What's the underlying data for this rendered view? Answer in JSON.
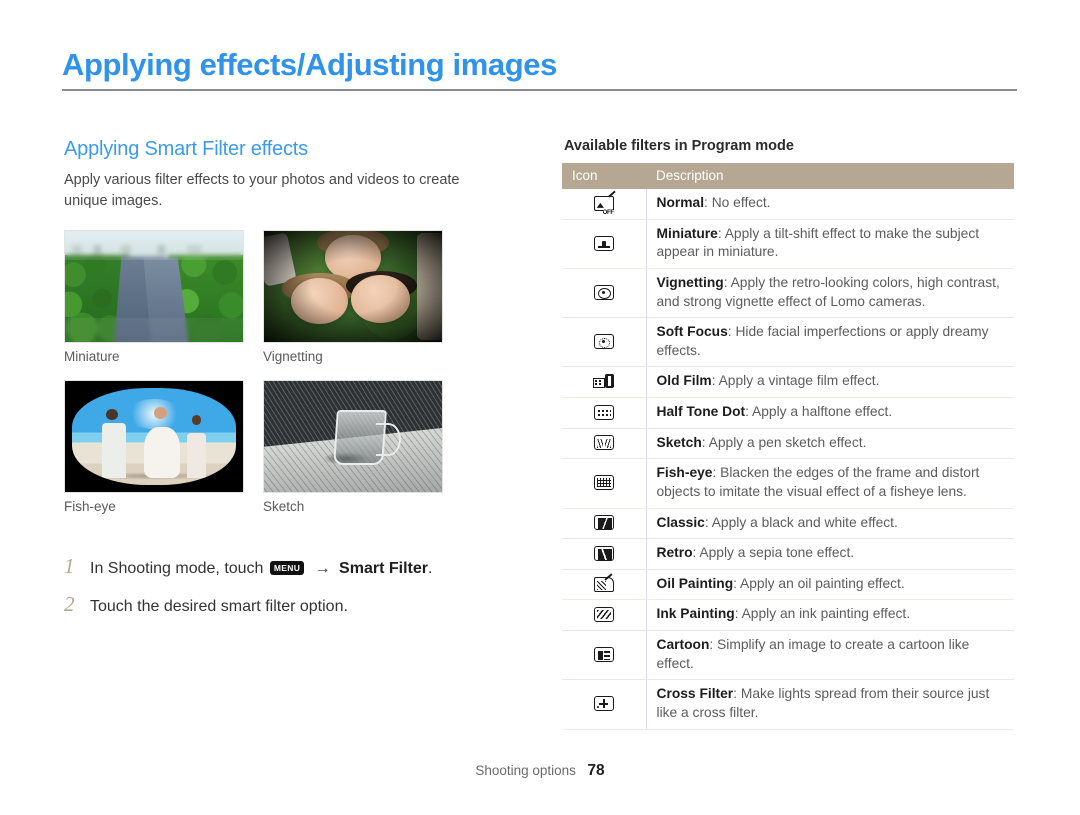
{
  "document": {
    "title": "Applying effects/Adjusting images",
    "footer_label": "Shooting options",
    "footer_page": "78"
  },
  "left_column": {
    "section_title": "Applying Smart Filter effects",
    "intro": "Apply various filter effects to your photos and videos to create unique images.",
    "samples": [
      {
        "caption": "Miniature",
        "art": "miniature"
      },
      {
        "caption": "Vignetting",
        "art": "vignetting"
      },
      {
        "caption": "Fish-eye",
        "art": "fisheye"
      },
      {
        "caption": "Sketch",
        "art": "sketch"
      }
    ],
    "steps": [
      {
        "number": "1",
        "before": "In Shooting mode, touch",
        "chip": "MENU",
        "arrow": "→",
        "bold": "Smart Filter",
        "after": "."
      },
      {
        "number": "2",
        "before": "Touch the desired smart filter option.",
        "chip": "",
        "arrow": "",
        "bold": "",
        "after": ""
      }
    ]
  },
  "right_column": {
    "table_caption": "Available filters in Program mode",
    "columns": {
      "icon": "Icon",
      "description": "Description"
    },
    "rows": [
      {
        "icon": "filter-normal-icon",
        "name": "Normal",
        "desc": ": No effect."
      },
      {
        "icon": "filter-miniature-icon",
        "name": "Miniature",
        "desc": ": Apply a tilt-shift effect to make the subject appear in miniature."
      },
      {
        "icon": "filter-vignetting-icon",
        "name": "Vignetting",
        "desc": ": Apply the retro-looking colors, high contrast, and strong vignette effect of Lomo cameras."
      },
      {
        "icon": "filter-soft-focus-icon",
        "name": "Soft Focus",
        "desc": ": Hide facial imperfections or apply dreamy effects."
      },
      {
        "icon": "filter-old-film-icon",
        "name": "Old Film",
        "desc": ": Apply a vintage film effect."
      },
      {
        "icon": "filter-half-tone-dot-icon",
        "name": "Half Tone Dot",
        "desc": ": Apply a halftone effect."
      },
      {
        "icon": "filter-sketch-icon",
        "name": "Sketch",
        "desc": ": Apply a pen sketch effect."
      },
      {
        "icon": "filter-fish-eye-icon",
        "name": "Fish-eye",
        "desc": ": Blacken the edges of the frame and distort objects to imitate the visual effect of a fisheye lens."
      },
      {
        "icon": "filter-classic-icon",
        "name": "Classic",
        "desc": ": Apply a black and white effect."
      },
      {
        "icon": "filter-retro-icon",
        "name": "Retro",
        "desc": ": Apply a sepia tone effect."
      },
      {
        "icon": "filter-oil-painting-icon",
        "name": "Oil Painting",
        "desc": ": Apply an oil painting effect."
      },
      {
        "icon": "filter-ink-painting-icon",
        "name": "Ink Painting",
        "desc": ": Apply an ink painting effect."
      },
      {
        "icon": "filter-cartoon-icon",
        "name": "Cartoon",
        "desc": ": Simplify an image to create a cartoon like effect."
      },
      {
        "icon": "filter-cross-filter-icon",
        "name": "Cross Filter",
        "desc": ": Make lights spread from their source just like a cross filter."
      }
    ]
  },
  "colors": {
    "title_blue": "#2f93ec",
    "section_blue": "#3a9bef",
    "table_header_tan": "#b5a792",
    "step_number_tan": "#b7a88f",
    "rule_gray": "#8c8c8c"
  }
}
